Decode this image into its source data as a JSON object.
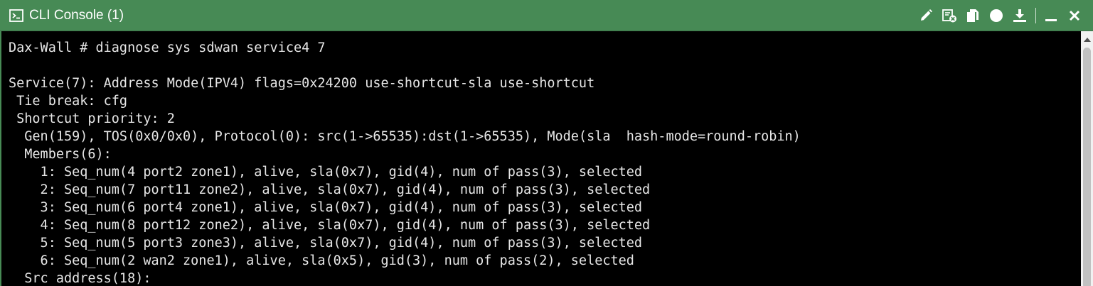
{
  "window": {
    "title": "CLI Console (1)",
    "title_icon": "terminal-icon",
    "accent_color": "#478a55"
  },
  "toolbar": {
    "buttons": [
      {
        "icon": "pencil-icon",
        "action": "edit"
      },
      {
        "icon": "clear-console-icon",
        "action": "clear"
      },
      {
        "icon": "copy-icon",
        "action": "copy"
      },
      {
        "icon": "record-icon",
        "action": "record"
      },
      {
        "icon": "download-icon",
        "action": "download"
      },
      {
        "icon": "minimize-icon",
        "action": "minimize"
      },
      {
        "icon": "close-icon",
        "action": "close"
      }
    ]
  },
  "terminal": {
    "text_color": "#e6e6e6",
    "background": "#000000",
    "lines": [
      "Dax-Wall # diagnose sys sdwan service4 7",
      "",
      "Service(7): Address Mode(IPV4) flags=0x24200 use-shortcut-sla use-shortcut",
      " Tie break: cfg",
      " Shortcut priority: 2",
      "  Gen(159), TOS(0x0/0x0), Protocol(0): src(1->65535):dst(1->65535), Mode(sla  hash-mode=round-robin)",
      "  Members(6):",
      "    1: Seq_num(4 port2 zone1), alive, sla(0x7), gid(4), num of pass(3), selected",
      "    2: Seq_num(7 port11 zone2), alive, sla(0x7), gid(4), num of pass(3), selected",
      "    3: Seq_num(6 port4 zone1), alive, sla(0x7), gid(4), num of pass(3), selected",
      "    4: Seq_num(8 port12 zone2), alive, sla(0x7), gid(4), num of pass(3), selected",
      "    5: Seq_num(5 port3 zone3), alive, sla(0x7), gid(4), num of pass(3), selected",
      "    6: Seq_num(2 wan2 zone1), alive, sla(0x5), gid(3), num of pass(2), selected",
      "  Src address(18):"
    ]
  }
}
